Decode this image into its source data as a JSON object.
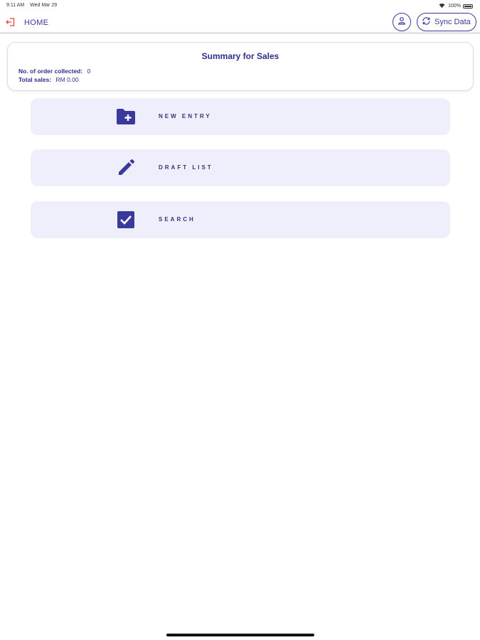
{
  "status_bar": {
    "time": "9:11 AM",
    "date": "Wed Mar 29",
    "battery": "100%"
  },
  "nav": {
    "title": "HOME",
    "sync_label": "Sync Data",
    "back_icon": "logout-icon",
    "user_icon": "user-icon",
    "sync_icon": "sync-icon"
  },
  "summary": {
    "heading": "Summary for Sales",
    "orders_label": "No. of order collected:",
    "orders_value": "0",
    "sales_label": "Total sales:",
    "sales_value": "RM 0.00"
  },
  "menu": [
    {
      "label": "NEW ENTRY",
      "icon": "folder-plus-icon"
    },
    {
      "label": "DRAFT LIST",
      "icon": "pencil-icon"
    },
    {
      "label": "SEARCH",
      "icon": "checkbox-icon"
    }
  ],
  "colors": {
    "primary": "#3a3a9c",
    "menu_bg": "#efeffb",
    "back_icon": "#e04a3a"
  }
}
